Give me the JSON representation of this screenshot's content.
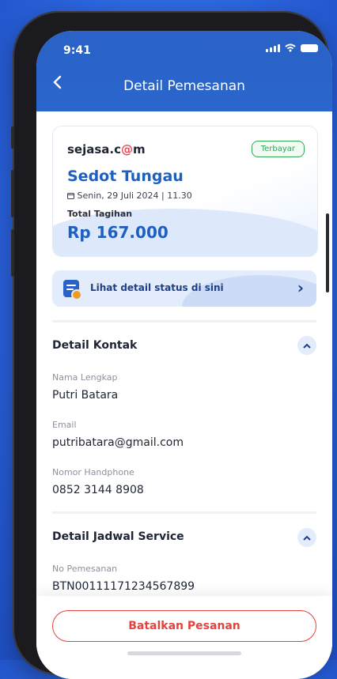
{
  "status_bar": {
    "time": "9:41"
  },
  "header": {
    "title": "Detail Pemesanan",
    "back_icon": "chevron-left-icon"
  },
  "order": {
    "brand_prefix": "sejasa.c",
    "brand_o": "@",
    "brand_suffix": "m",
    "badge": "Terbayar",
    "service": "Sedot Tungau",
    "date": "Senin, 29 Juli 2024 | 11.30",
    "total_label": "Total Tagihan",
    "total": "Rp 167.000"
  },
  "status_link": {
    "label": "Lihat detail status di sini"
  },
  "contact": {
    "title": "Detail Kontak",
    "name_label": "Nama Lengkap",
    "name": "Putri Batara",
    "email_label": "Email",
    "email": "putribatara@gmail.com",
    "phone_label": "Nomor Handphone",
    "phone": "0852 3144 8908"
  },
  "schedule": {
    "title": "Detail Jadwal Service",
    "order_no_label": "No Pemesanan",
    "order_no": "BTN00111171234567899"
  },
  "footer": {
    "cancel_label": "Batalkan Pesanan"
  },
  "colors": {
    "primary": "#2a62c7",
    "accent_text": "#1f5fbf",
    "danger": "#e2433f",
    "success": "#2fa84f"
  }
}
